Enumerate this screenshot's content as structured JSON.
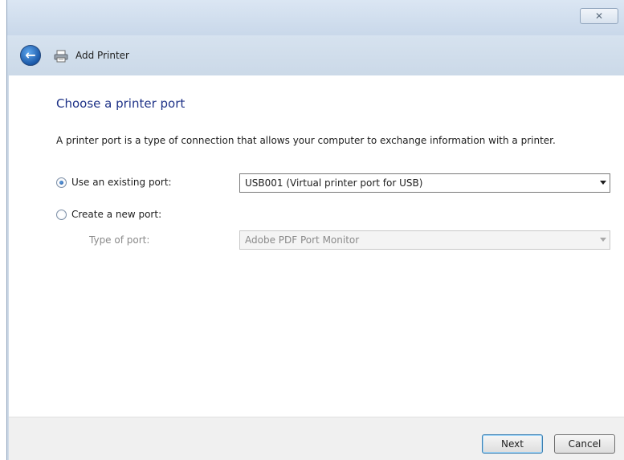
{
  "window": {
    "title": "Add Printer",
    "close_glyph": "✕",
    "back_glyph": "←"
  },
  "page": {
    "heading": "Choose a printer port",
    "description": "A printer port is a type of connection that allows your computer to exchange information with a printer."
  },
  "options": {
    "existing": {
      "label": "Use an existing port:",
      "checked": true,
      "selected_value": "USB001 (Virtual printer port for USB)"
    },
    "new": {
      "label": "Create a new port:",
      "checked": false,
      "type_label": "Type of port:",
      "selected_value": "Adobe PDF Port Monitor",
      "disabled": true
    }
  },
  "buttons": {
    "next": "Next",
    "cancel": "Cancel"
  },
  "icons": {
    "back": "back-arrow-icon",
    "printer": "printer-icon",
    "close": "close-icon",
    "dropdown": "chevron-down-icon"
  },
  "colors": {
    "heading": "#1e3287",
    "titlebar": "#cfdbe8",
    "default_button_border": "#3c7fb1"
  }
}
